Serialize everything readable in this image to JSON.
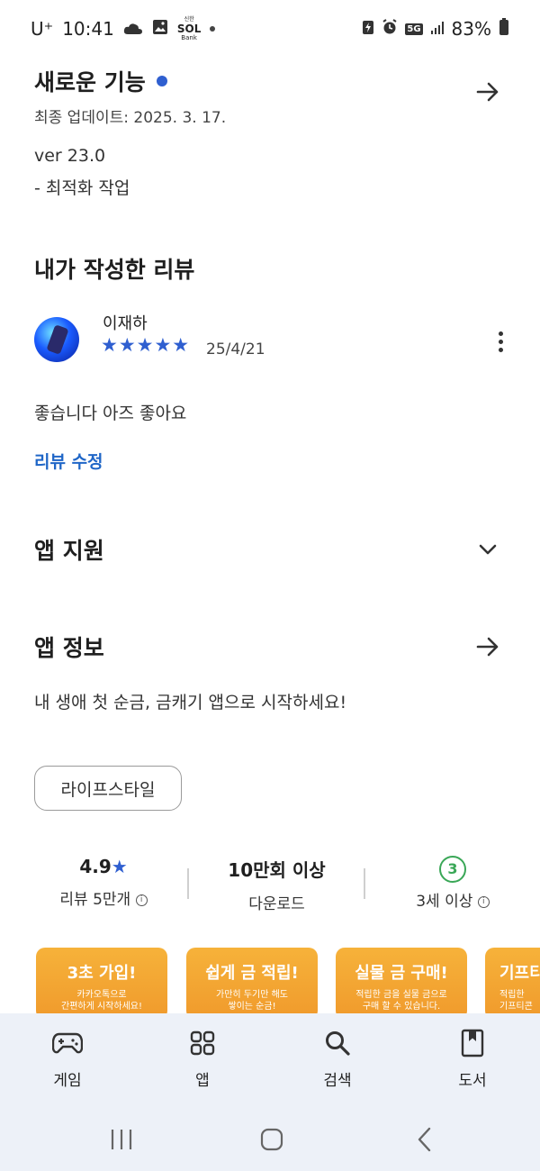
{
  "status_bar": {
    "carrier": "U⁺",
    "time": "10:41",
    "app_label_top": "신한",
    "app_label_mid": "SOL",
    "app_label_bottom": "Bank",
    "network": "5G",
    "battery": "83%"
  },
  "whats_new": {
    "title": "새로운 기능",
    "updated": "최종 업데이트: 2025. 3. 17.",
    "version": "ver 23.0",
    "note": "- 최적화 작업"
  },
  "my_review": {
    "heading": "내가 작성한 리뷰",
    "author": "이재하",
    "stars": "★★★★★",
    "date": "25/4/21",
    "text": "좋습니다 아즈 좋아요",
    "edit_label": "리뷰 수정"
  },
  "app_support": {
    "title": "앱 지원"
  },
  "app_info": {
    "title": "앱 정보",
    "description": "내 생애 첫 순금, 금캐기 앱으로 시작하세요!",
    "category_chip": "라이프스타일"
  },
  "stats": {
    "rating_value": "4.9",
    "rating_star": "★",
    "rating_label": "리뷰 5만개",
    "downloads_value": "10만회 이상",
    "downloads_label": "다운로드",
    "age_badge": "3",
    "age_label": "3세 이상"
  },
  "screenshots": [
    {
      "title": "3초 가입!",
      "sub1": "카카오톡으로",
      "sub2": "간편하게 시작하세요!"
    },
    {
      "title": "쉽게 금 적립!",
      "sub1": "가만히 두기만 해도",
      "sub2": "쌓이는 순금!"
    },
    {
      "title": "실물 금 구매!",
      "sub1": "적립한 금을 실물 금으로",
      "sub2": "구매 할 수 있습니다."
    },
    {
      "title": "기프티",
      "sub1": "적립한",
      "sub2": "기프티콘"
    }
  ],
  "bottom_nav": {
    "games": "게임",
    "apps": "앱",
    "search": "검색",
    "books": "도서"
  },
  "colors": {
    "accent_blue": "#1f66c7",
    "star_blue": "#2f5fd0",
    "dot_blue": "#2f5fd0",
    "age_green": "#3aa757",
    "nav_bg": "#edf1f8",
    "promo_orange": "#f4a534"
  }
}
